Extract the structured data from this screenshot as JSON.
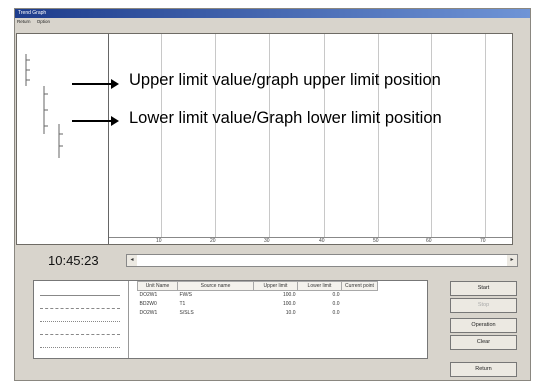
{
  "window": {
    "title": "Trend Graph"
  },
  "menu": [
    "Return",
    "Option"
  ],
  "annotations": {
    "upper": "Upper limit value/graph upper limit position",
    "lower": "Lower limit value/Graph lower limit position"
  },
  "graph": {
    "ticks": [
      "10",
      "20",
      "30",
      "40",
      "50",
      "60",
      "70"
    ]
  },
  "clock": "10:45:23",
  "scrollbar": {
    "left": "◂",
    "right": "▸"
  },
  "table": {
    "headers": [
      "Unit Name",
      "Source name",
      "Upper limit",
      "Lower limit",
      "Current point"
    ],
    "rows": [
      [
        "DO2W1",
        "FW/S",
        "100.0",
        "0.0",
        ""
      ],
      [
        "BD2W0",
        "T1",
        "100.0",
        "0.0",
        ""
      ],
      [
        "DO2W1",
        "S/SLS",
        "10.0",
        "0.0",
        ""
      ]
    ]
  },
  "buttons": {
    "start": "Start",
    "stop": "Stop",
    "operation": "Operation",
    "clear": "Clear",
    "return": "Return"
  }
}
